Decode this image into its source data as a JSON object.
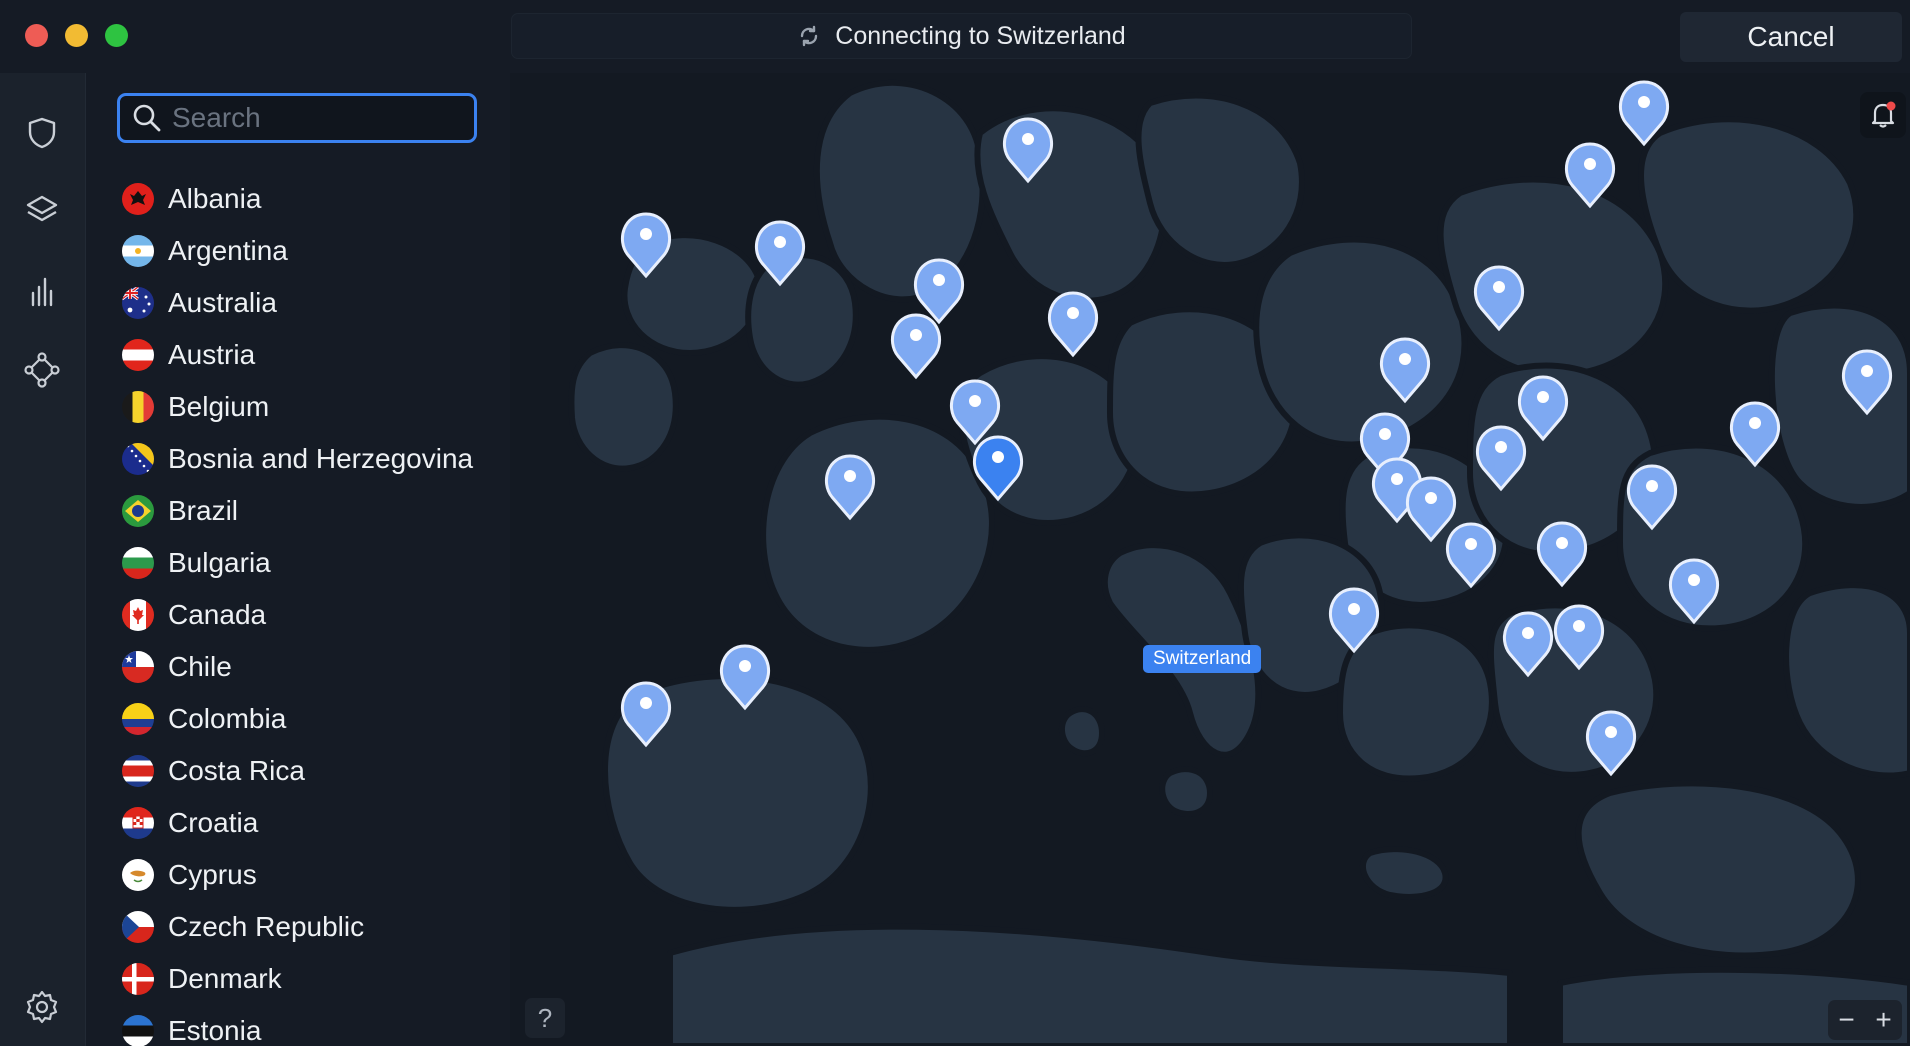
{
  "window": {
    "status_text": "Connecting to Switzerland",
    "cancel_label": "Cancel"
  },
  "rail": {
    "icons": [
      "shield-icon",
      "layers-icon",
      "stats-icon",
      "meshnet-icon",
      "settings-icon"
    ]
  },
  "search": {
    "placeholder": "Search"
  },
  "countries": [
    {
      "name": "Albania"
    },
    {
      "name": "Argentina"
    },
    {
      "name": "Australia"
    },
    {
      "name": "Austria"
    },
    {
      "name": "Belgium"
    },
    {
      "name": "Bosnia and Herzegovina"
    },
    {
      "name": "Brazil"
    },
    {
      "name": "Bulgaria"
    },
    {
      "name": "Canada"
    },
    {
      "name": "Chile"
    },
    {
      "name": "Colombia"
    },
    {
      "name": "Costa Rica"
    },
    {
      "name": "Croatia"
    },
    {
      "name": "Cyprus"
    },
    {
      "name": "Czech Republic"
    },
    {
      "name": "Denmark"
    },
    {
      "name": "Estonia"
    }
  ],
  "map": {
    "selected_label": "Switzerland",
    "help_label": "?",
    "zoom_out_label": "−",
    "zoom_in_label": "+"
  },
  "colors": {
    "accent": "#3b82f0",
    "pin": "#7ea9f2",
    "land": "#273443",
    "sea": "#131922"
  }
}
